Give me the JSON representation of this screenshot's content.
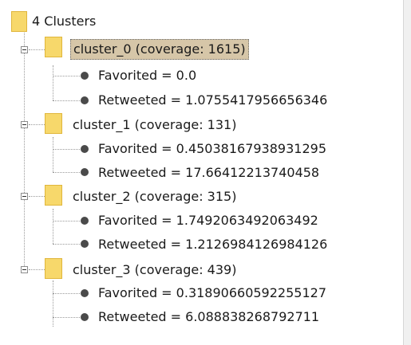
{
  "tree": {
    "root_label": "4 Clusters",
    "clusters": [
      {
        "label": "cluster_0 (coverage: 1615)",
        "selected": true,
        "items": [
          "Favorited = 0.0",
          "Retweeted = 1.0755417956656346"
        ]
      },
      {
        "label": "cluster_1 (coverage: 131)",
        "selected": false,
        "items": [
          "Favorited = 0.45038167938931295",
          "Retweeted = 17.66412213740458"
        ]
      },
      {
        "label": "cluster_2 (coverage: 315)",
        "selected": false,
        "items": [
          "Favorited = 1.7492063492063492",
          "Retweeted = 1.2126984126984126"
        ]
      },
      {
        "label": "cluster_3 (coverage: 439)",
        "selected": false,
        "items": [
          "Favorited = 0.31890660592255127",
          "Retweeted = 6.088838268792711"
        ]
      }
    ]
  },
  "colors": {
    "folder": "#f7d86b",
    "selection": "#d6c6a8",
    "text": "#1a1a1a"
  },
  "icons": {
    "folder": "folder-icon",
    "leaf": "bullet-icon",
    "expander": "collapse-icon"
  }
}
